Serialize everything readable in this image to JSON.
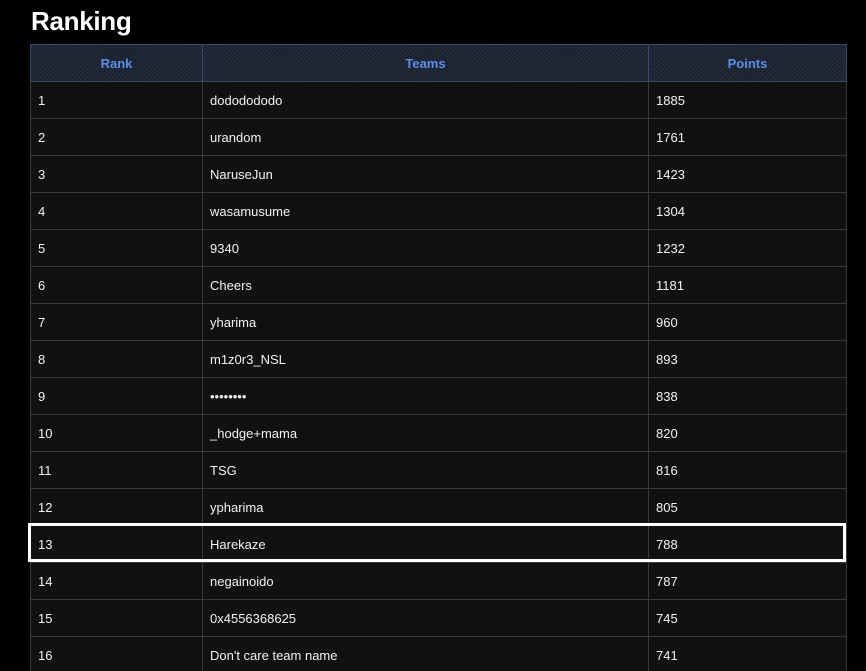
{
  "page": {
    "title": "Ranking"
  },
  "table": {
    "headers": {
      "rank": "Rank",
      "teams": "Teams",
      "points": "Points"
    },
    "rows": [
      {
        "rank": "1",
        "team": "dododododo",
        "points": "1885"
      },
      {
        "rank": "2",
        "team": "urandom",
        "points": "1761"
      },
      {
        "rank": "3",
        "team": "NaruseJun",
        "points": "1423"
      },
      {
        "rank": "4",
        "team": "wasamusume",
        "points": "1304"
      },
      {
        "rank": "5",
        "team": "9340",
        "points": "1232"
      },
      {
        "rank": "6",
        "team": "Cheers",
        "points": "1181"
      },
      {
        "rank": "7",
        "team": "yharima",
        "points": "960"
      },
      {
        "rank": "8",
        "team": "m1z0r3_NSL",
        "points": "893"
      },
      {
        "rank": "9",
        "team": "••••••••",
        "points": "838"
      },
      {
        "rank": "10",
        "team": "_hodge+mama",
        "points": "820"
      },
      {
        "rank": "11",
        "team": "TSG",
        "points": "816"
      },
      {
        "rank": "12",
        "team": "ypharima",
        "points": "805"
      },
      {
        "rank": "13",
        "team": "Harekaze",
        "points": "788"
      },
      {
        "rank": "14",
        "team": "negainoido",
        "points": "787"
      },
      {
        "rank": "15",
        "team": "0x4556368625",
        "points": "745"
      },
      {
        "rank": "16",
        "team": "Don't care team name",
        "points": "741"
      }
    ],
    "highlighted_rank": "13"
  },
  "colors": {
    "background": "#000000",
    "header_text": "#5b8fe6",
    "cell_text": "#f2f2f2",
    "highlight_border": "#ffffff"
  }
}
